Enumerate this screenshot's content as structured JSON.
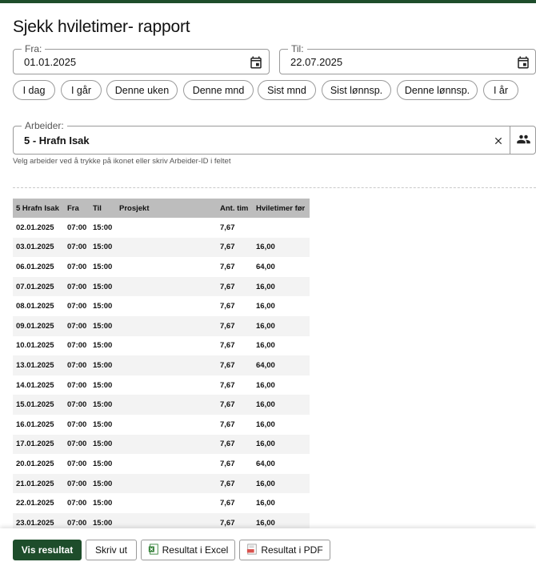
{
  "page": {
    "title": "Sjekk hviletimer- rapport"
  },
  "date_from": {
    "label": "Fra:",
    "value": "01.01.2025",
    "icon": "calendar-icon"
  },
  "date_to": {
    "label": "Til:",
    "value": "22.07.2025",
    "icon": "calendar-icon"
  },
  "quick_ranges": [
    "I dag",
    "I går",
    "Denne uken",
    "Denne mnd",
    "Sist mnd",
    "Sist lønnsp.",
    "Denne lønnsp.",
    "I år"
  ],
  "worker": {
    "label": "Arbeider:",
    "value": "5 - Hrafn Isak",
    "helper": "Velg arbeider ved å trykke på ikonet eller skriv Arbeider-ID i feltet",
    "clear_icon": "close-icon",
    "picker_icon": "people-icon"
  },
  "table": {
    "headers": [
      "5 Hrafn Isak",
      "Fra",
      "Til",
      "Prosjekt",
      "Ant. tim",
      "Hviletimer før"
    ],
    "rows": [
      [
        "02.01.2025",
        "07:00",
        "15:00",
        "",
        "7,67",
        ""
      ],
      [
        "03.01.2025",
        "07:00",
        "15:00",
        "",
        "7,67",
        "16,00"
      ],
      [
        "06.01.2025",
        "07:00",
        "15:00",
        "",
        "7,67",
        "64,00"
      ],
      [
        "07.01.2025",
        "07:00",
        "15:00",
        "",
        "7,67",
        "16,00"
      ],
      [
        "08.01.2025",
        "07:00",
        "15:00",
        "",
        "7,67",
        "16,00"
      ],
      [
        "09.01.2025",
        "07:00",
        "15:00",
        "",
        "7,67",
        "16,00"
      ],
      [
        "10.01.2025",
        "07:00",
        "15:00",
        "",
        "7,67",
        "16,00"
      ],
      [
        "13.01.2025",
        "07:00",
        "15:00",
        "",
        "7,67",
        "64,00"
      ],
      [
        "14.01.2025",
        "07:00",
        "15:00",
        "",
        "7,67",
        "16,00"
      ],
      [
        "15.01.2025",
        "07:00",
        "15:00",
        "",
        "7,67",
        "16,00"
      ],
      [
        "16.01.2025",
        "07:00",
        "15:00",
        "",
        "7,67",
        "16,00"
      ],
      [
        "17.01.2025",
        "07:00",
        "15:00",
        "",
        "7,67",
        "16,00"
      ],
      [
        "20.01.2025",
        "07:00",
        "15:00",
        "",
        "7,67",
        "64,00"
      ],
      [
        "21.01.2025",
        "07:00",
        "15:00",
        "",
        "7,67",
        "16,00"
      ],
      [
        "22.01.2025",
        "07:00",
        "15:00",
        "",
        "7,67",
        "16,00"
      ],
      [
        "23.01.2025",
        "07:00",
        "15:00",
        "",
        "7,67",
        "16,00"
      ]
    ]
  },
  "footer": {
    "show_results": "Vis resultat",
    "print": "Skriv ut",
    "excel": "Resultat i Excel",
    "excel_icon": "excel-icon",
    "pdf": "Resultat i PDF",
    "pdf_icon": "pdf-icon"
  },
  "colors": {
    "primary": "#1e4d2b",
    "header_bg": "#bdbdbd",
    "row_alt": "#f3f3f3"
  }
}
